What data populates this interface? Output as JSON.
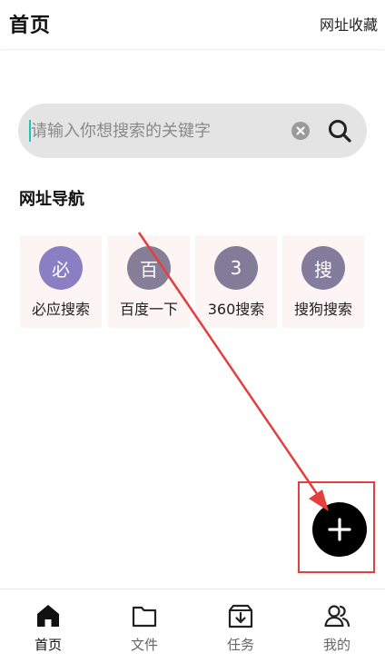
{
  "header": {
    "title": "首页",
    "bookmarks_label": "网址收藏"
  },
  "search": {
    "placeholder": "请输入你想搜索的关键字",
    "clear_icon": "close-circle-icon",
    "search_icon": "search-icon"
  },
  "nav": {
    "title": "网址导航",
    "items": [
      {
        "avatar": "必",
        "label": "必应搜索",
        "color": "#8b7fc4"
      },
      {
        "avatar": "百",
        "label": "百度一下",
        "color": "#857e96"
      },
      {
        "avatar": "3",
        "label": "360搜索",
        "color": "#827c99"
      },
      {
        "avatar": "搜",
        "label": "搜狗搜索",
        "color": "#857b9c"
      }
    ]
  },
  "fab": {
    "icon": "plus-icon"
  },
  "annotation": {
    "color": "#e53e3e"
  },
  "tabbar": {
    "items": [
      {
        "label": "首页",
        "icon": "home-icon",
        "active": true
      },
      {
        "label": "文件",
        "icon": "folder-icon",
        "active": false
      },
      {
        "label": "任务",
        "icon": "download-box-icon",
        "active": false
      },
      {
        "label": "我的",
        "icon": "user-group-icon",
        "active": false
      }
    ]
  }
}
